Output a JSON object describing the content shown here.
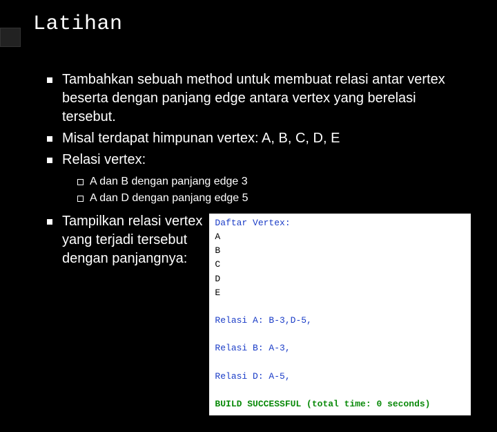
{
  "title": "Latihan",
  "bullets": {
    "b1": "Tambahkan sebuah method untuk membuat relasi antar vertex beserta dengan panjang edge antara vertex yang berelasi tersebut.",
    "b2": "Misal terdapat himpunan vertex: A, B, C, D, E",
    "b3": "Relasi vertex:",
    "b3_sub1": "A dan B dengan panjang edge 3",
    "b3_sub2": "A dan D dengan panjang edge 5",
    "b4_line1": "Tampilkan relasi vertex",
    "b4_line2": "yang terjadi tersebut",
    "b4_line3": "dengan panjangnya:"
  },
  "console": {
    "header": "Daftar Vertex:",
    "vA": "A",
    "vB": "B",
    "vC": "C",
    "vD": "D",
    "vE": "E",
    "relA": "Relasi A: B-3,D-5,",
    "relB": "Relasi B: A-3,",
    "relD": "Relasi D: A-5,",
    "build": "BUILD SUCCESSFUL (total time: 0 seconds)"
  }
}
